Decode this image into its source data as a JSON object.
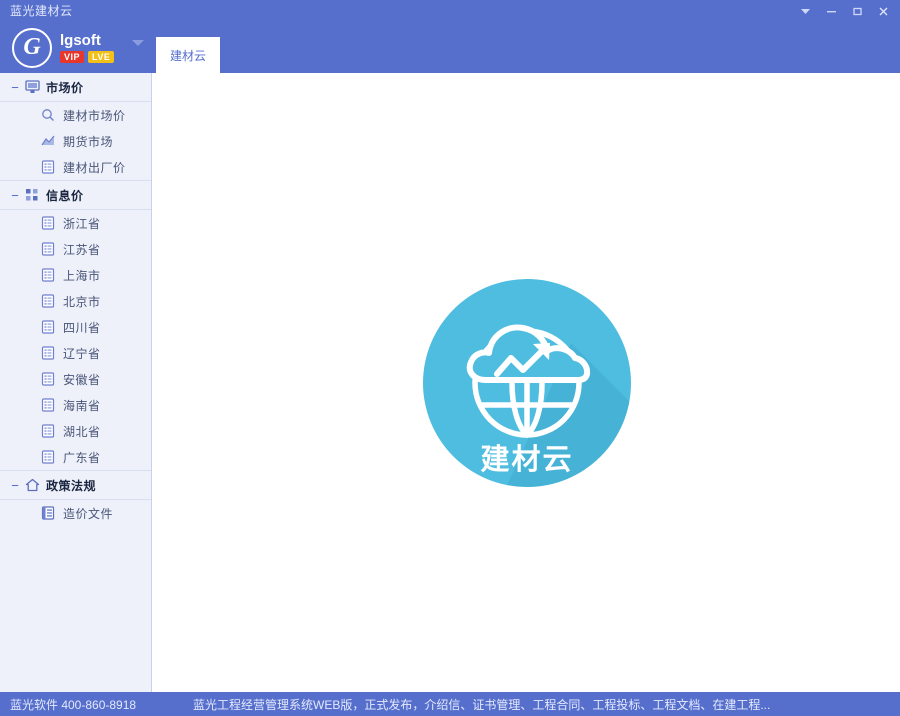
{
  "window": {
    "title": "蓝光建材云",
    "controls": [
      {
        "name": "menu-dropdown",
        "glyph": "▼"
      },
      {
        "name": "minimize",
        "glyph": "—"
      },
      {
        "name": "maximize",
        "glyph": "□"
      },
      {
        "name": "close",
        "glyph": "✕"
      }
    ]
  },
  "brand": {
    "mark": "G",
    "name": "lgsoft",
    "badge_vip": "VIP",
    "badge_lve": "LVE"
  },
  "tabs": [
    {
      "label": "建材云",
      "active": true
    }
  ],
  "sidebar": {
    "groups": [
      {
        "title": "市场价",
        "icon": "monitor-icon",
        "toggle": "−",
        "items": [
          {
            "label": "建材市场价",
            "icon": "search-icon"
          },
          {
            "label": "期货市场",
            "icon": "chart-icon"
          },
          {
            "label": "建材出厂价",
            "icon": "list-icon"
          }
        ]
      },
      {
        "title": "信息价",
        "icon": "grid-icon",
        "toggle": "−",
        "items": [
          {
            "label": "浙江省",
            "icon": "list-icon"
          },
          {
            "label": "江苏省",
            "icon": "list-icon"
          },
          {
            "label": "上海市",
            "icon": "list-icon"
          },
          {
            "label": "北京市",
            "icon": "list-icon"
          },
          {
            "label": "四川省",
            "icon": "list-icon"
          },
          {
            "label": "辽宁省",
            "icon": "list-icon"
          },
          {
            "label": "安徽省",
            "icon": "list-icon"
          },
          {
            "label": "海南省",
            "icon": "list-icon"
          },
          {
            "label": "湖北省",
            "icon": "list-icon"
          },
          {
            "label": "广东省",
            "icon": "list-icon"
          }
        ]
      },
      {
        "title": "政策法规",
        "icon": "home-icon",
        "toggle": "−",
        "items": [
          {
            "label": "造价文件",
            "icon": "document-icon"
          }
        ]
      }
    ]
  },
  "content": {
    "hero_logo_text": "建材云",
    "hero_icon": "cloud-globe-chart-icon"
  },
  "statusbar": {
    "left": "蓝光软件 400-860-8918",
    "right": "蓝光工程经营管理系统WEB版，正式发布，介绍信、证书管理、工程合同、工程投标、工程文档、在建工程..."
  },
  "colors": {
    "header_blue": "#566fcc",
    "sidebar_bg": "#eef1fa",
    "hero_cyan": "#4ebde0",
    "hero_shadow": "#3aa5c9",
    "badge_vip": "#e8362b",
    "badge_lve": "#f2c017",
    "tab_active_text": "#566fcc"
  }
}
